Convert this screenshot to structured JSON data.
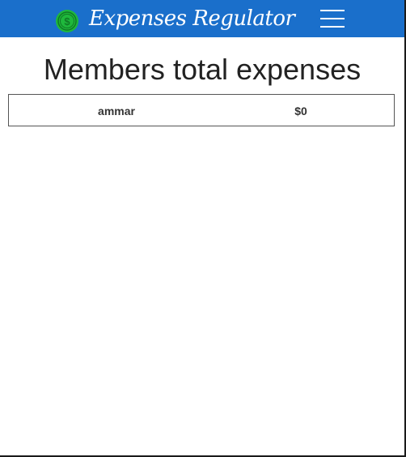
{
  "app": {
    "brand_text": "Expenses Regulator",
    "brand_icon": "dollar-coin-icon",
    "menu_icon": "hamburger-menu-icon"
  },
  "colors": {
    "navbar": "#1a6fcb",
    "brand_icon": "#1fb83c",
    "text": "#222222",
    "table_border": "#555555"
  },
  "main": {
    "title": "Members total expenses",
    "members": [
      {
        "name": "ammar",
        "total": "$0"
      }
    ]
  }
}
